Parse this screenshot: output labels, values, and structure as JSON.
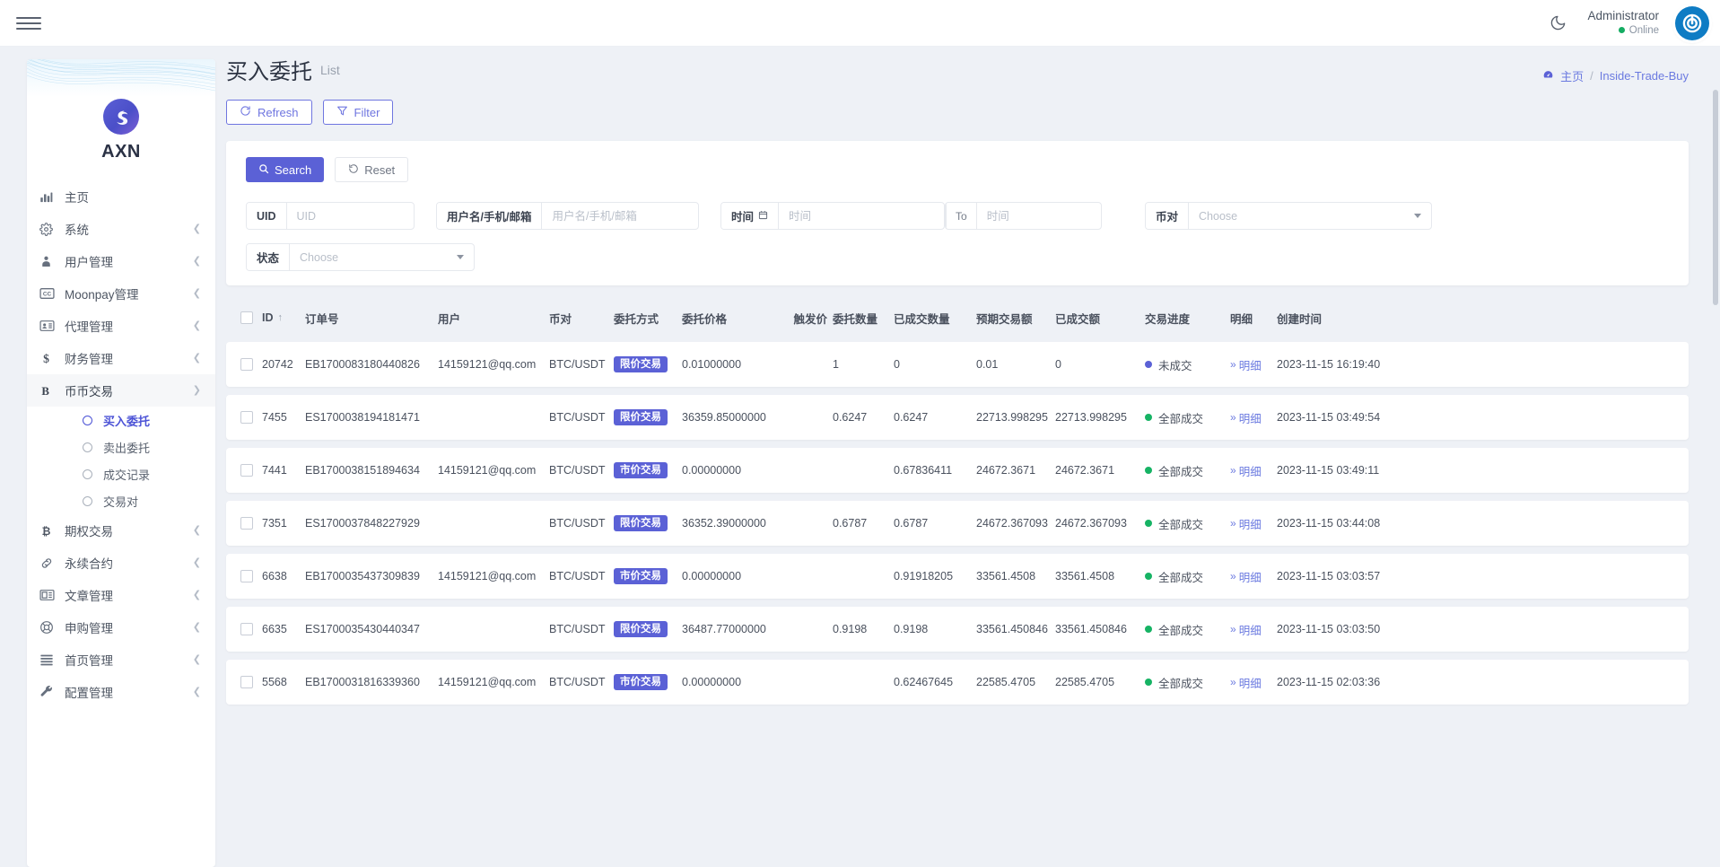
{
  "topbar": {
    "menu_icon": "hamburger-icon",
    "theme_icon": "moon-icon",
    "user_name": "Administrator",
    "user_status": "Online",
    "avatar_icon": "power-avatar-icon"
  },
  "sidebar": {
    "brand": "AXN",
    "items": [
      {
        "label": "主页",
        "icon": "chart-bars-icon",
        "expandable": false
      },
      {
        "label": "系统",
        "icon": "gear-icon",
        "expandable": true
      },
      {
        "label": "用户管理",
        "icon": "user-tie-icon",
        "expandable": true
      },
      {
        "label": "Moonpay管理",
        "icon": "cc-icon",
        "expandable": true
      },
      {
        "label": "代理管理",
        "icon": "id-card-icon",
        "expandable": true
      },
      {
        "label": "财务管理",
        "icon": "dollar-icon",
        "expandable": true
      },
      {
        "label": "币币交易",
        "icon": "bold-b-icon",
        "expandable": true,
        "expanded": true
      },
      {
        "label": "期权交易",
        "icon": "bitcoin-icon",
        "expandable": true
      },
      {
        "label": "永续合约",
        "icon": "link-icon",
        "expandable": true
      },
      {
        "label": "文章管理",
        "icon": "newspaper-icon",
        "expandable": true
      },
      {
        "label": "申购管理",
        "icon": "lifebuoy-icon",
        "expandable": true
      },
      {
        "label": "首页管理",
        "icon": "lines-icon",
        "expandable": true
      },
      {
        "label": "配置管理",
        "icon": "wrench-icon",
        "expandable": true
      }
    ],
    "sub_items": [
      {
        "label": "买入委托",
        "current": true
      },
      {
        "label": "卖出委托",
        "current": false
      },
      {
        "label": "成交记录",
        "current": false
      },
      {
        "label": "交易对",
        "current": false
      }
    ],
    "accent_color": "#4b52d6"
  },
  "page": {
    "title": "买入委托",
    "subtitle": "List",
    "breadcrumb_home": "主页",
    "breadcrumb_current": "Inside-Trade-Buy",
    "breadcrumb_home_icon": "dashboard-icon",
    "breadcrumb_separator": "/"
  },
  "toolbar": {
    "refresh_label": "Refresh",
    "refresh_icon": "refresh-icon",
    "filter_label": "Filter",
    "filter_icon": "funnel-icon"
  },
  "search_panel": {
    "search_label": "Search",
    "search_icon": "search-icon",
    "reset_label": "Reset",
    "reset_icon": "undo-icon",
    "fields": {
      "uid": {
        "label": "UID",
        "value": "",
        "placeholder": "UID"
      },
      "user": {
        "label": "用户名/手机/邮箱",
        "value": "",
        "placeholder": "用户名/手机/邮箱"
      },
      "time": {
        "label": "时间",
        "icon": "calendar-icon",
        "value": "",
        "placeholder": "时间"
      },
      "time_to": {
        "separator": "To",
        "value": "",
        "placeholder": "时间"
      },
      "pair": {
        "label": "币对",
        "value": "",
        "placeholder": "Choose"
      },
      "state": {
        "label": "状态",
        "value": "",
        "placeholder": "Choose"
      }
    }
  },
  "table": {
    "columns": [
      "ID",
      "订单号",
      "用户",
      "币对",
      "委托方式",
      "委托价格",
      "触发价",
      "委托数量",
      "已成交数量",
      "预期交易额",
      "已成交额",
      "交易进度",
      "明细",
      "创建时间"
    ],
    "sort_column": "ID",
    "sort_direction": "asc",
    "detail_label": "明细",
    "rows": [
      {
        "id": "20742",
        "order_no": "EB1700083180440826",
        "user": "14159121@qq.com",
        "pair": "BTC/USDT",
        "order_type": "限价交易",
        "order_price": "0.01000000",
        "trigger_price": "",
        "order_qty": "1",
        "filled_qty": "0",
        "expected_amount": "0.01",
        "filled_amount": "0",
        "progress": "未成交",
        "progress_color": "blue",
        "created_at": "2023-11-15 16:19:40"
      },
      {
        "id": "7455",
        "order_no": "ES1700038194181471",
        "user": "",
        "pair": "BTC/USDT",
        "order_type": "限价交易",
        "order_price": "36359.85000000",
        "trigger_price": "",
        "order_qty": "0.6247",
        "filled_qty": "0.6247",
        "expected_amount": "22713.998295",
        "filled_amount": "22713.998295",
        "progress": "全部成交",
        "progress_color": "green",
        "created_at": "2023-11-15 03:49:54"
      },
      {
        "id": "7441",
        "order_no": "EB1700038151894634",
        "user": "14159121@qq.com",
        "pair": "BTC/USDT",
        "order_type": "市价交易",
        "order_price": "0.00000000",
        "trigger_price": "",
        "order_qty": "",
        "filled_qty": "0.67836411",
        "expected_amount": "24672.3671",
        "filled_amount": "24672.3671",
        "progress": "全部成交",
        "progress_color": "green",
        "created_at": "2023-11-15 03:49:11"
      },
      {
        "id": "7351",
        "order_no": "ES1700037848227929",
        "user": "",
        "pair": "BTC/USDT",
        "order_type": "限价交易",
        "order_price": "36352.39000000",
        "trigger_price": "",
        "order_qty": "0.6787",
        "filled_qty": "0.6787",
        "expected_amount": "24672.367093",
        "filled_amount": "24672.367093",
        "progress": "全部成交",
        "progress_color": "green",
        "created_at": "2023-11-15 03:44:08"
      },
      {
        "id": "6638",
        "order_no": "EB1700035437309839",
        "user": "14159121@qq.com",
        "pair": "BTC/USDT",
        "order_type": "市价交易",
        "order_price": "0.00000000",
        "trigger_price": "",
        "order_qty": "",
        "filled_qty": "0.91918205",
        "expected_amount": "33561.4508",
        "filled_amount": "33561.4508",
        "progress": "全部成交",
        "progress_color": "green",
        "created_at": "2023-11-15 03:03:57"
      },
      {
        "id": "6635",
        "order_no": "ES1700035430440347",
        "user": "",
        "pair": "BTC/USDT",
        "order_type": "限价交易",
        "order_price": "36487.77000000",
        "trigger_price": "",
        "order_qty": "0.9198",
        "filled_qty": "0.9198",
        "expected_amount": "33561.450846",
        "filled_amount": "33561.450846",
        "progress": "全部成交",
        "progress_color": "green",
        "created_at": "2023-11-15 03:03:50"
      },
      {
        "id": "5568",
        "order_no": "EB1700031816339360",
        "user": "14159121@qq.com",
        "pair": "BTC/USDT",
        "order_type": "市价交易",
        "order_price": "0.00000000",
        "trigger_price": "",
        "order_qty": "",
        "filled_qty": "0.62467645",
        "expected_amount": "22585.4705",
        "filled_amount": "22585.4705",
        "progress": "全部成交",
        "progress_color": "green",
        "created_at": "2023-11-15 02:03:36"
      }
    ]
  },
  "colors": {
    "accent": "#5b61d6",
    "success": "#16b364",
    "link": "#6b7ae0",
    "page_bg": "#eef1f6"
  }
}
